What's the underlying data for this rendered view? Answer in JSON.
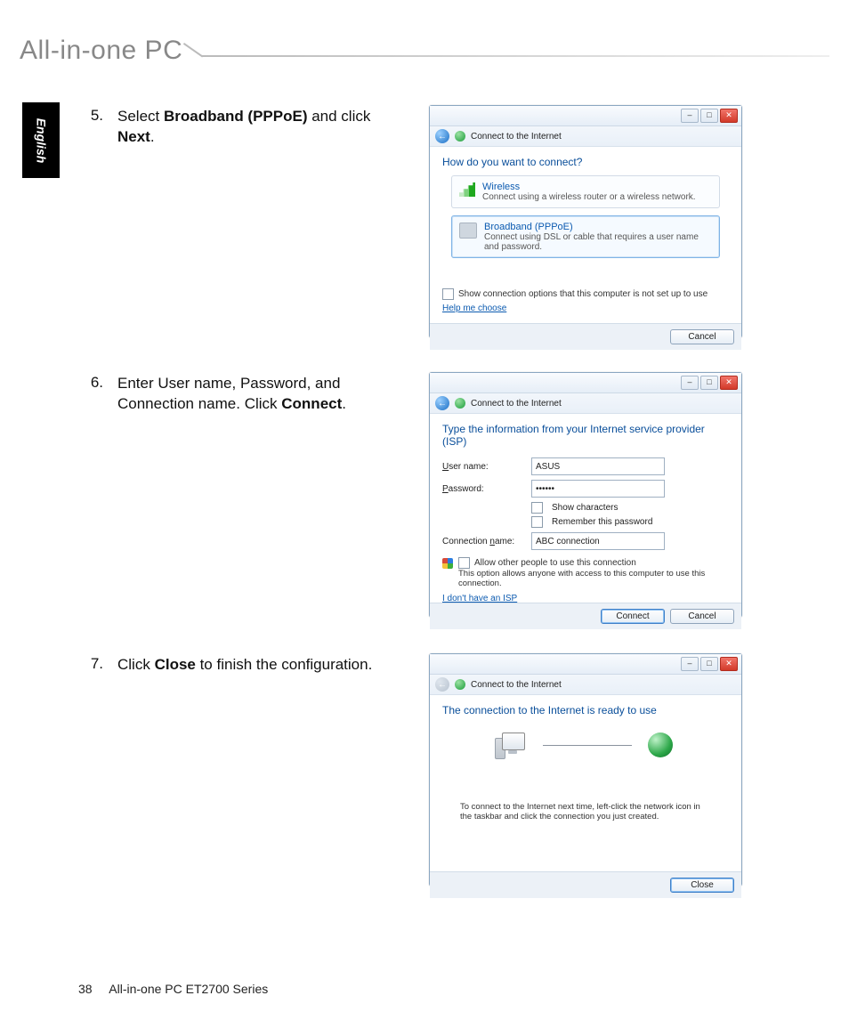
{
  "header": {
    "title": "All-in-one PC"
  },
  "sideTab": {
    "label": "English"
  },
  "steps": {
    "s5": {
      "num": "5.",
      "pre": "Select ",
      "b1": "Broadband (PPPoE)",
      "mid": " and click ",
      "b2": "Next",
      "post": "."
    },
    "s6": {
      "num": "6.",
      "pre": "Enter User name, Password, and Connection name. Click ",
      "b1": "Connect",
      "post": "."
    },
    "s7": {
      "num": "7.",
      "pre": "Click ",
      "b1": "Close",
      "post": " to finish the configuration."
    }
  },
  "dlg": {
    "winTitle": "Connect to the Internet",
    "minGlyph": "–",
    "maxGlyph": "□",
    "closeGlyph": "✕",
    "backGlyph": "←"
  },
  "dlg5": {
    "heading": "How do you want to connect?",
    "opt1": {
      "name": "Wireless",
      "desc": "Connect using a wireless router or a wireless network."
    },
    "opt2": {
      "name": "Broadband (PPPoE)",
      "desc": "Connect using DSL or cable that requires a user name and password."
    },
    "showMore": "Show connection options that this computer is not set up to use",
    "help": "Help me choose",
    "cancel": "Cancel"
  },
  "dlg6": {
    "heading": "Type the information from your Internet service provider (ISP)",
    "userLbl_u": "U",
    "userLbl_r": "ser name:",
    "passLbl_u": "P",
    "passLbl_r": "assword:",
    "connLbl_pre": "Connection ",
    "connLbl_u": "n",
    "connLbl_r": "ame:",
    "userVal": "ASUS",
    "passVal": "••••••",
    "show_u": "S",
    "show_r": "how characters",
    "rem_u": "R",
    "rem_r": "emember this password",
    "connVal": "ABC connection",
    "allow_u": "A",
    "allow_r": "llow other people to use this connection",
    "allowDesc": "This option allows anyone with access to this computer to use this connection.",
    "noIsp": "I don't have an ISP",
    "connect": "Connect",
    "cancel": "Cancel"
  },
  "dlg7": {
    "heading": "The connection to the Internet is ready to use",
    "note": "To connect to the Internet next time, left-click the network icon in the taskbar and click the connection you just created.",
    "close": "Close"
  },
  "footer": {
    "page": "38",
    "text": "All-in-one PC ET2700 Series"
  }
}
